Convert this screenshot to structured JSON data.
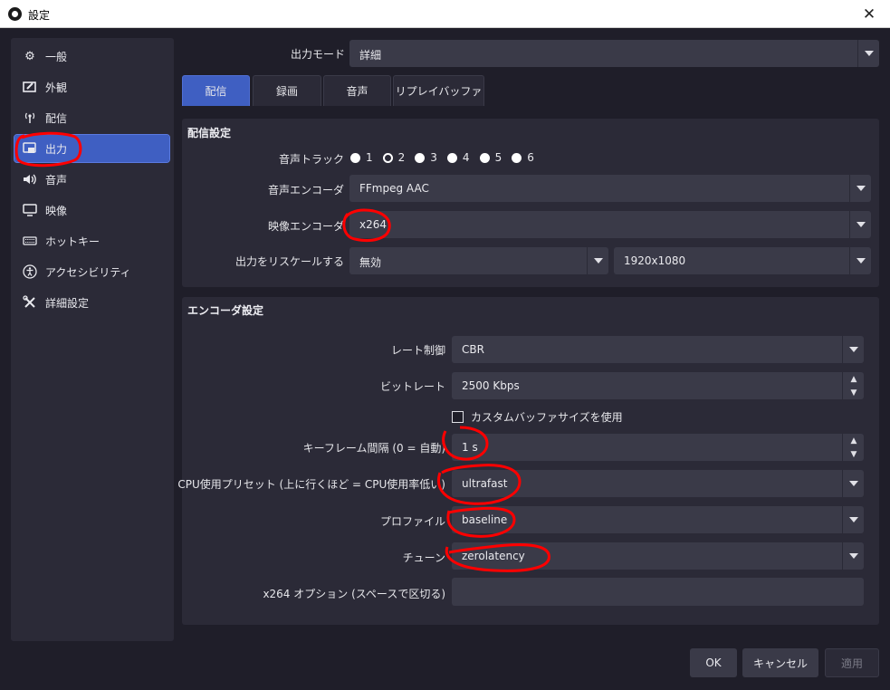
{
  "window": {
    "title": "設定",
    "close_icon": "close-icon"
  },
  "sidebar": {
    "items": [
      {
        "label": "一般",
        "icon": "gear-icon"
      },
      {
        "label": "外観",
        "icon": "appearance-icon"
      },
      {
        "label": "配信",
        "icon": "antenna-icon"
      },
      {
        "label": "出力",
        "icon": "output-icon",
        "active": true
      },
      {
        "label": "音声",
        "icon": "speaker-icon"
      },
      {
        "label": "映像",
        "icon": "monitor-icon"
      },
      {
        "label": "ホットキー",
        "icon": "keyboard-icon"
      },
      {
        "label": "アクセシビリティ",
        "icon": "accessibility-icon"
      },
      {
        "label": "詳細設定",
        "icon": "tools-icon"
      }
    ]
  },
  "output_mode": {
    "label": "出力モード",
    "value": "詳細"
  },
  "tabs": [
    {
      "label": "配信",
      "active": true
    },
    {
      "label": "録画"
    },
    {
      "label": "音声"
    },
    {
      "label": "リプレイバッファ"
    }
  ],
  "stream_settings": {
    "title": "配信設定",
    "audio_track": {
      "label": "音声トラック",
      "options": [
        "1",
        "2",
        "3",
        "4",
        "5",
        "6"
      ],
      "selected": "2"
    },
    "audio_encoder": {
      "label": "音声エンコーダ",
      "value": "FFmpeg AAC"
    },
    "video_encoder": {
      "label": "映像エンコーダ",
      "value": "x264"
    },
    "rescale": {
      "label": "出力をリスケールする",
      "value": "無効",
      "resolution": "1920x1080"
    }
  },
  "encoder_settings": {
    "title": "エンコーダ設定",
    "rate_control": {
      "label": "レート制御",
      "value": "CBR"
    },
    "bitrate": {
      "label": "ビットレート",
      "value": "2500 Kbps"
    },
    "custom_buffer": {
      "label": "カスタムバッファサイズを使用",
      "checked": false
    },
    "keyframe": {
      "label": "キーフレーム間隔 (0 = 自動)",
      "value": "1 s"
    },
    "cpu_preset": {
      "label": "CPU使用プリセット (上に行くほど = CPU使用率低い)",
      "value": "ultrafast"
    },
    "profile": {
      "label": "プロファイル",
      "value": "baseline"
    },
    "tune": {
      "label": "チューン",
      "value": "zerolatency"
    },
    "x264_options": {
      "label": "x264 オプション (スペースで区切る)",
      "value": ""
    }
  },
  "buttons": {
    "ok": "OK",
    "cancel": "キャンセル",
    "apply": "適用"
  },
  "colors": {
    "accent": "#3f5fc2",
    "background": "#1f1e29",
    "panel": "#2b2a37",
    "annotation": "#ff0000"
  }
}
